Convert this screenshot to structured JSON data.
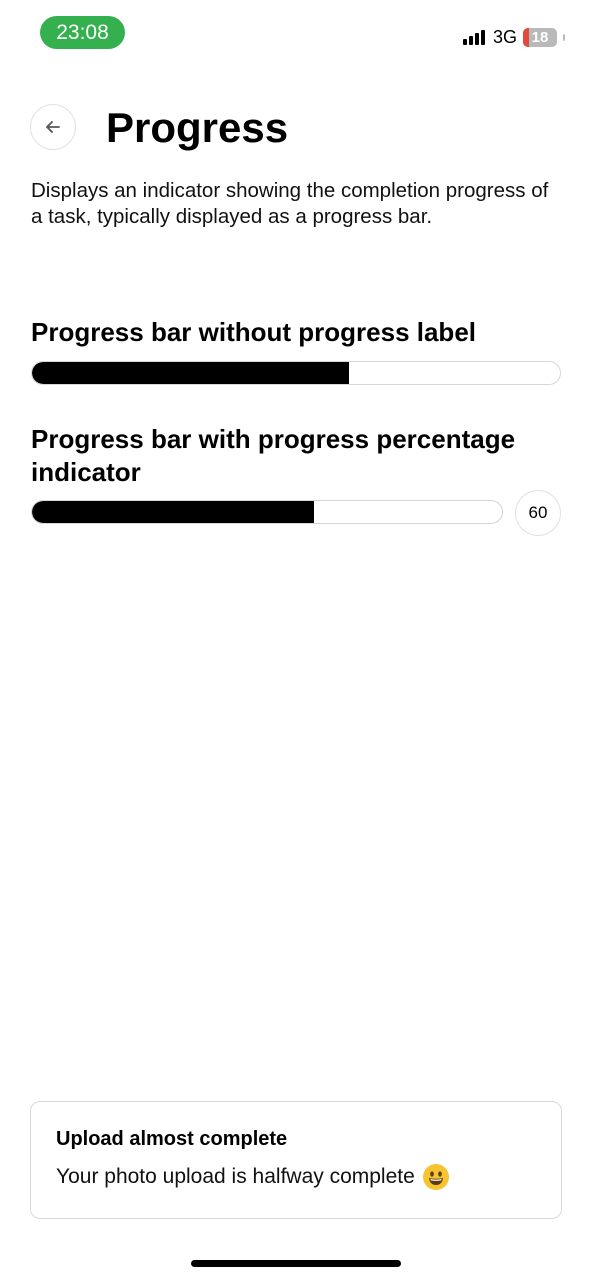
{
  "status_bar": {
    "time": "23:08",
    "network": "3G",
    "battery": "18",
    "time_color": "#34b04f"
  },
  "header": {
    "back_icon": "arrow-left-icon",
    "title": "Progress"
  },
  "description": "Displays an indicator showing the completion progress of a task, typically displayed as a progress bar.",
  "sections": [
    {
      "title": "Progress bar without progress label",
      "progress": 0.6
    },
    {
      "title": "Progress bar with progress percentage indicator",
      "progress": 0.6,
      "label": "60"
    }
  ],
  "toast": {
    "title": "Upload almost complete",
    "message": "Your photo upload is halfway complete",
    "emoji_icon": "grinning-face-icon"
  }
}
